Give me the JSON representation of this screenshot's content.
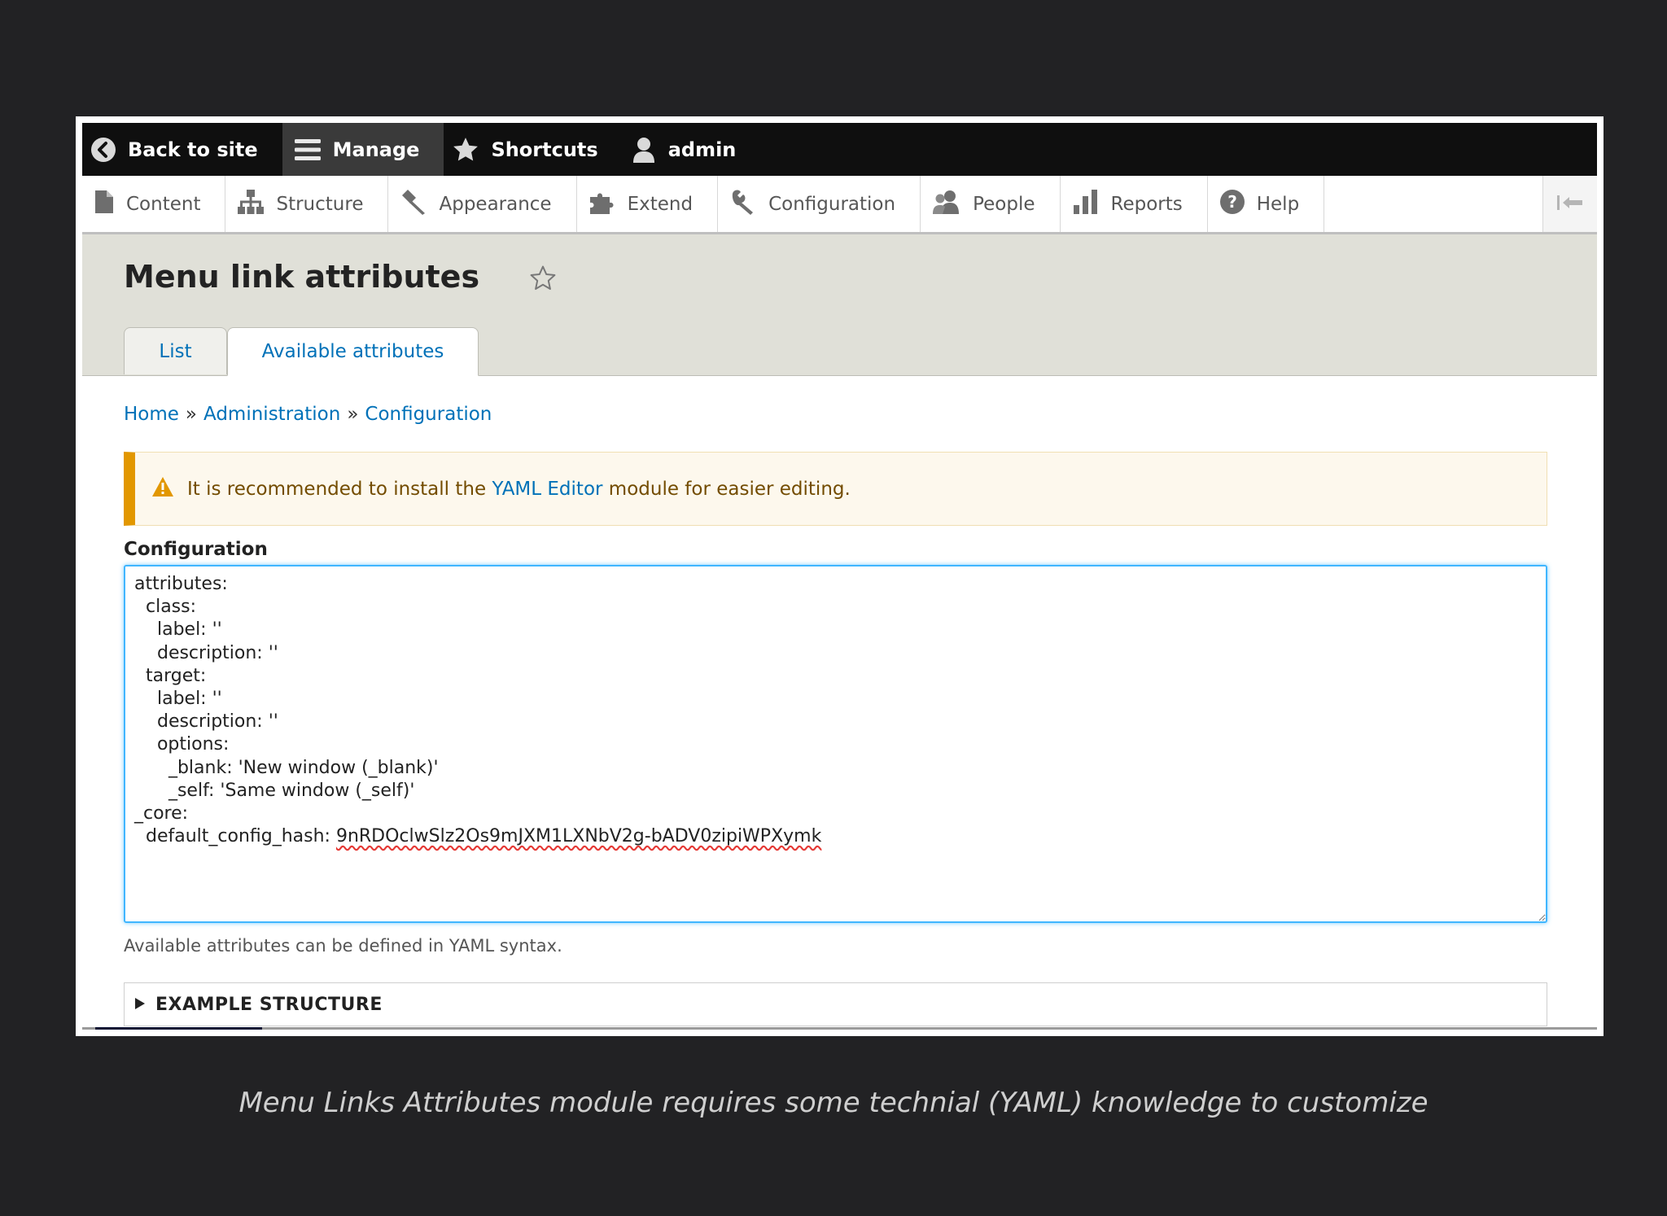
{
  "toolbar": {
    "back_label": "Back to site",
    "manage_label": "Manage",
    "shortcuts_label": "Shortcuts",
    "user_label": "admin"
  },
  "admin_menu": {
    "items": [
      {
        "label": "Content",
        "icon": "page-icon"
      },
      {
        "label": "Structure",
        "icon": "sitemap-icon"
      },
      {
        "label": "Appearance",
        "icon": "paintbrush-icon"
      },
      {
        "label": "Extend",
        "icon": "puzzle-icon"
      },
      {
        "label": "Configuration",
        "icon": "wrench-icon"
      },
      {
        "label": "People",
        "icon": "people-icon"
      },
      {
        "label": "Reports",
        "icon": "bar-chart-icon"
      },
      {
        "label": "Help",
        "icon": "help-icon"
      }
    ]
  },
  "page": {
    "title": "Menu link attributes",
    "tabs": [
      {
        "label": "List",
        "active": false
      },
      {
        "label": "Available attributes",
        "active": true
      }
    ]
  },
  "breadcrumb": {
    "home": "Home",
    "separator": "»",
    "administration": "Administration",
    "configuration": "Configuration"
  },
  "warning": {
    "prefix": "It is recommended to install the",
    "link": "YAML Editor",
    "suffix": "module for easier editing."
  },
  "form": {
    "label": "Configuration",
    "value_before_hash": "attributes:\n  class:\n    label: ''\n    description: ''\n  target:\n    label: ''\n    description: ''\n    options:\n      _blank: 'New window (_blank)'\n      _self: 'Same window (_self)'\n_core:\n  default_config_hash: ",
    "hash": "9nRDOclwSlz2Os9mJXM1LXNbV2g-bADV0zipiWPXymk",
    "description": "Available attributes can be defined in YAML syntax.",
    "details_label": "EXAMPLE STRUCTURE"
  },
  "caption": "Menu Links Attributes module requires some technial (YAML) knowledge to customize",
  "colors": {
    "toolbar_bg": "#0f0f0f",
    "link": "#0071b8",
    "warning_accent": "#e29700",
    "focus_border": "#40b6ff",
    "header_bg": "#e0e0d8"
  }
}
